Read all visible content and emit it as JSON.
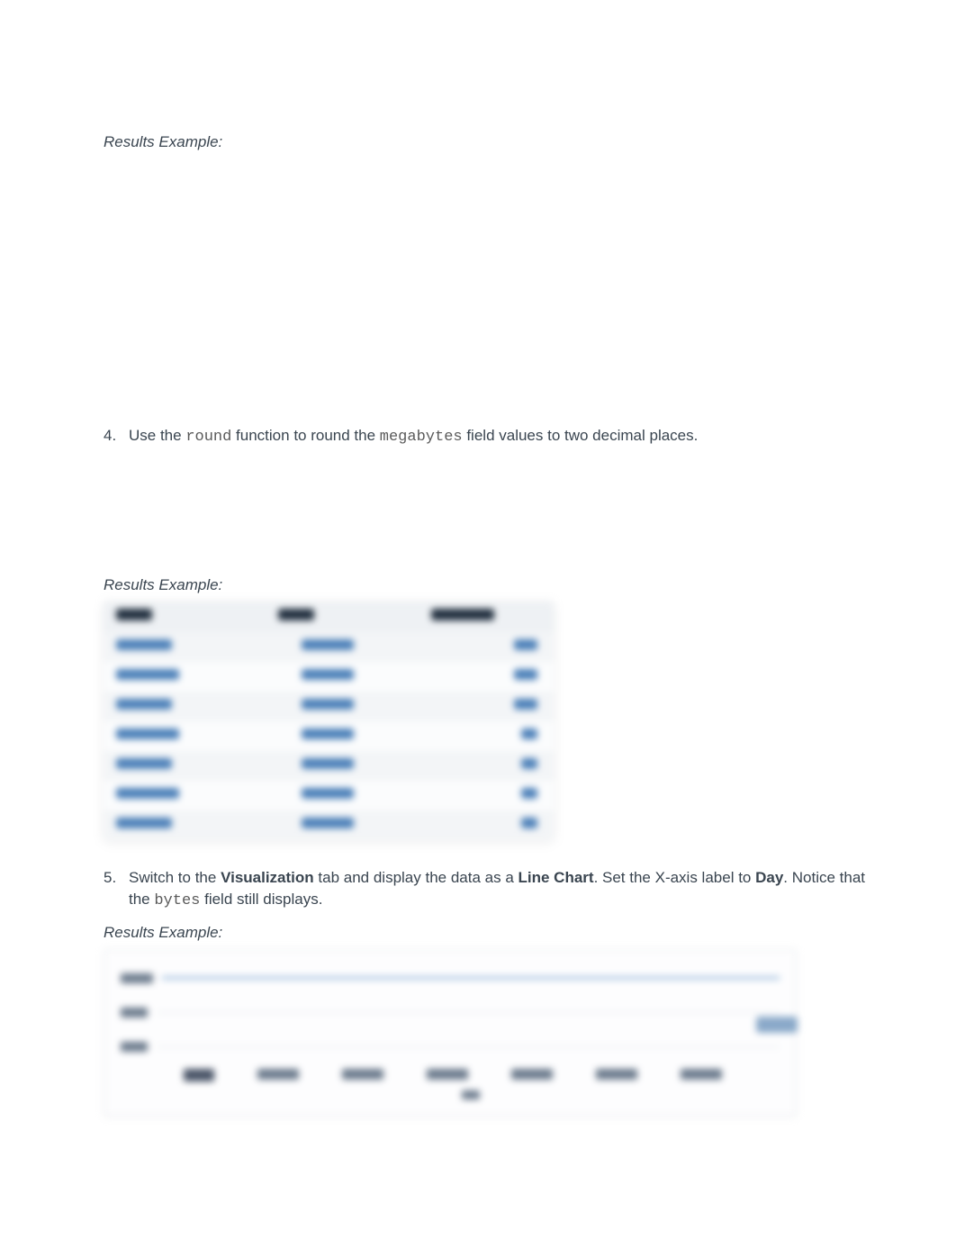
{
  "labels": {
    "results_example_1": "Results Example:",
    "results_example_2": "Results Example:",
    "results_example_3": "Results Example:"
  },
  "steps": {
    "s4": {
      "num": "4.",
      "pre": "Use the ",
      "code1": "round",
      "mid": " function to round the ",
      "code2": "megabytes",
      "post": " field values to two decimal places."
    },
    "s5": {
      "num": "5.",
      "pre": "Switch to the ",
      "b1": "Visualization",
      "mid1": " tab and display the data as a ",
      "b2": "Line Chart",
      "mid2": ". Set the X-axis label to ",
      "b3": "Day",
      "mid3": ". Notice that the ",
      "code1": "bytes",
      "post": " field still displays."
    }
  }
}
